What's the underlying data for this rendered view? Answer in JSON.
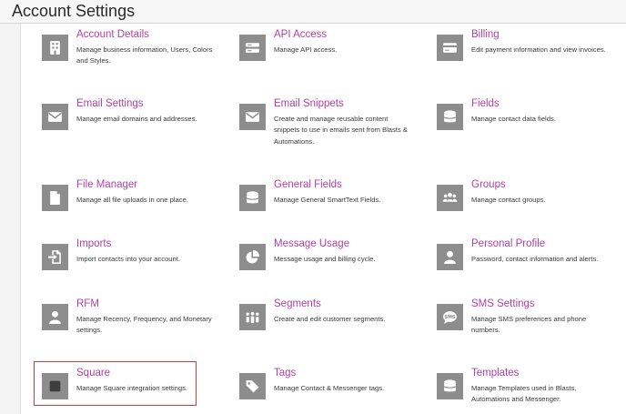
{
  "page": {
    "title": "Account Settings"
  },
  "items": [
    {
      "title": "Account Details",
      "desc": "Manage business information, Users, Colors and Styles.",
      "icon": "building-icon"
    },
    {
      "title": "API Access",
      "desc": "Manage API access.",
      "icon": "server-icon"
    },
    {
      "title": "Billing",
      "desc": "Edit payment information and view invoices.",
      "icon": "credit-card-icon"
    },
    {
      "title": "Email Settings",
      "desc": "Manage email domains and addresses.",
      "icon": "envelope-icon"
    },
    {
      "title": "Email Snippets",
      "desc": "Create and manage reusable content snippets to use in emails sent from Blasts & Automations.",
      "icon": "envelope-icon"
    },
    {
      "title": "Fields",
      "desc": "Manage contact data fields.",
      "icon": "database-icon"
    },
    {
      "title": "File Manager",
      "desc": "Manage all file uploads in one place.",
      "icon": "file-icon"
    },
    {
      "title": "General Fields",
      "desc": "Manage General SmartText Fields.",
      "icon": "database-icon"
    },
    {
      "title": "Groups",
      "desc": "Manage contact groups.",
      "icon": "users-icon"
    },
    {
      "title": "Imports",
      "desc": "Import contacts into your account.",
      "icon": "file-import-icon"
    },
    {
      "title": "Message Usage",
      "desc": "Message usage and billing cycle.",
      "icon": "pie-chart-icon"
    },
    {
      "title": "Personal Profile",
      "desc": "Password, contact information and alerts.",
      "icon": "user-icon"
    },
    {
      "title": "RFM",
      "desc": "Manage Recency, Frequency, and Monetary settings.",
      "icon": "user-icon"
    },
    {
      "title": "Segments",
      "desc": "Create and edit customer segments.",
      "icon": "people-group-icon"
    },
    {
      "title": "SMS Settings",
      "desc": "Manage SMS preferences and phone numbers.",
      "icon": "sms-icon"
    },
    {
      "title": "Square",
      "desc": "Manage Square integration settings.",
      "icon": "square-icon"
    },
    {
      "title": "Tags",
      "desc": "Manage Contact & Messenger tags.",
      "icon": "tags-icon"
    },
    {
      "title": "Templates",
      "desc": "Manage Templates used in Blasts, Automations and Messenger.",
      "icon": "database-icon"
    }
  ],
  "highlight": {
    "target": "Square"
  }
}
